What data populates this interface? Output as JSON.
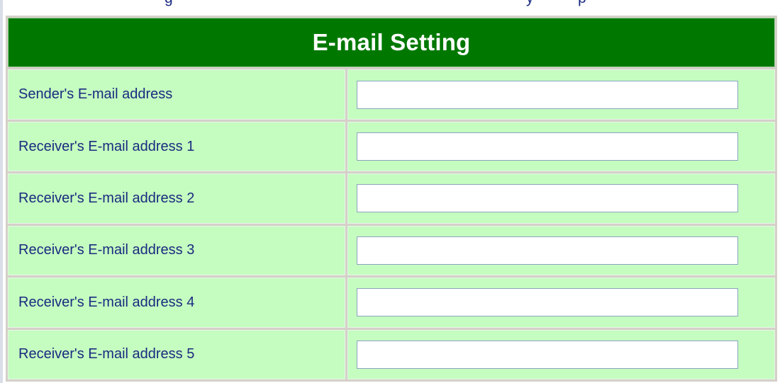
{
  "top_fragment": {
    "glyphs": [
      "g",
      "y",
      "p"
    ]
  },
  "email_setting": {
    "title": "E-mail Setting",
    "rows": [
      {
        "label": "Sender's E-mail address",
        "value": ""
      },
      {
        "label": "Receiver's E-mail address 1",
        "value": ""
      },
      {
        "label": "Receiver's E-mail address 2",
        "value": ""
      },
      {
        "label": "Receiver's E-mail address 3",
        "value": ""
      },
      {
        "label": "Receiver's E-mail address 4",
        "value": ""
      },
      {
        "label": "Receiver's E-mail address 5",
        "value": ""
      }
    ]
  },
  "colors": {
    "header_background": "#007800",
    "row_background": "#c5fdc0",
    "label_text": "#1a2a80",
    "table_border": "#d4d0c8"
  }
}
